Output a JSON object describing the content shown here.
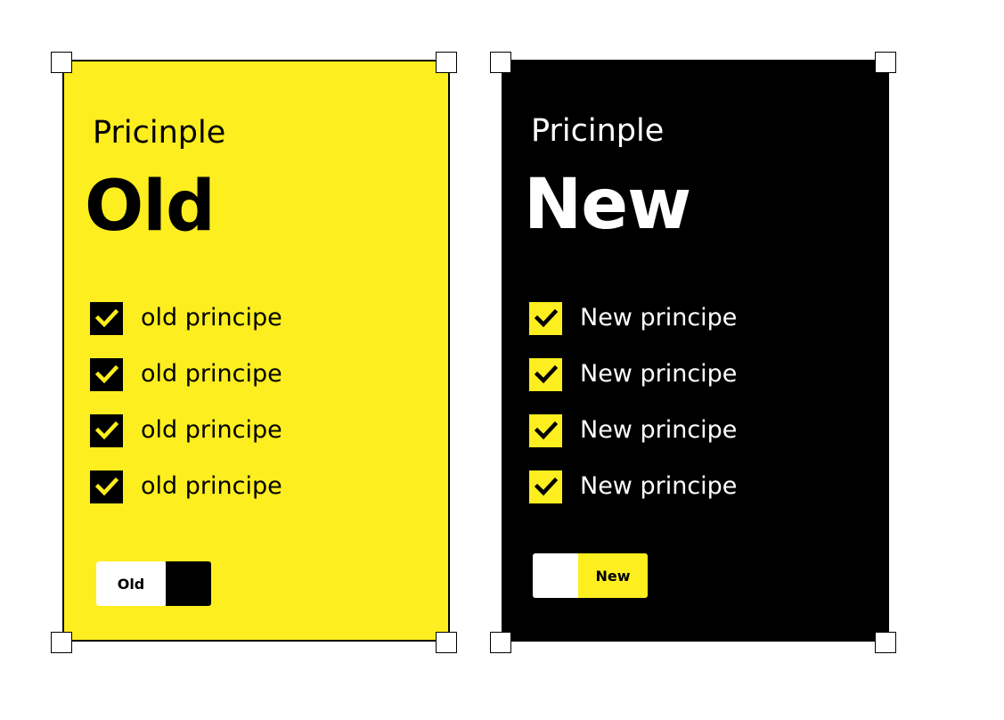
{
  "colors": {
    "accent_yellow": "#fdee1f",
    "dark": "#000000",
    "light": "#ffffff"
  },
  "cards": [
    {
      "id": "old",
      "label": "Pricinple",
      "title": "Old",
      "items": [
        "old principe",
        "old principe",
        "old principe",
        "old principe"
      ],
      "toggle": {
        "active_label": "Old",
        "active_side": "left"
      }
    },
    {
      "id": "new",
      "label": "Pricinple",
      "title": "New",
      "items": [
        "New principe",
        "New principe",
        "New principe",
        "New principe"
      ],
      "toggle": {
        "active_label": "New",
        "active_side": "right"
      }
    }
  ],
  "icons": {
    "checkbox": "checkmark-icon",
    "resize_handle": "resize-handle"
  }
}
